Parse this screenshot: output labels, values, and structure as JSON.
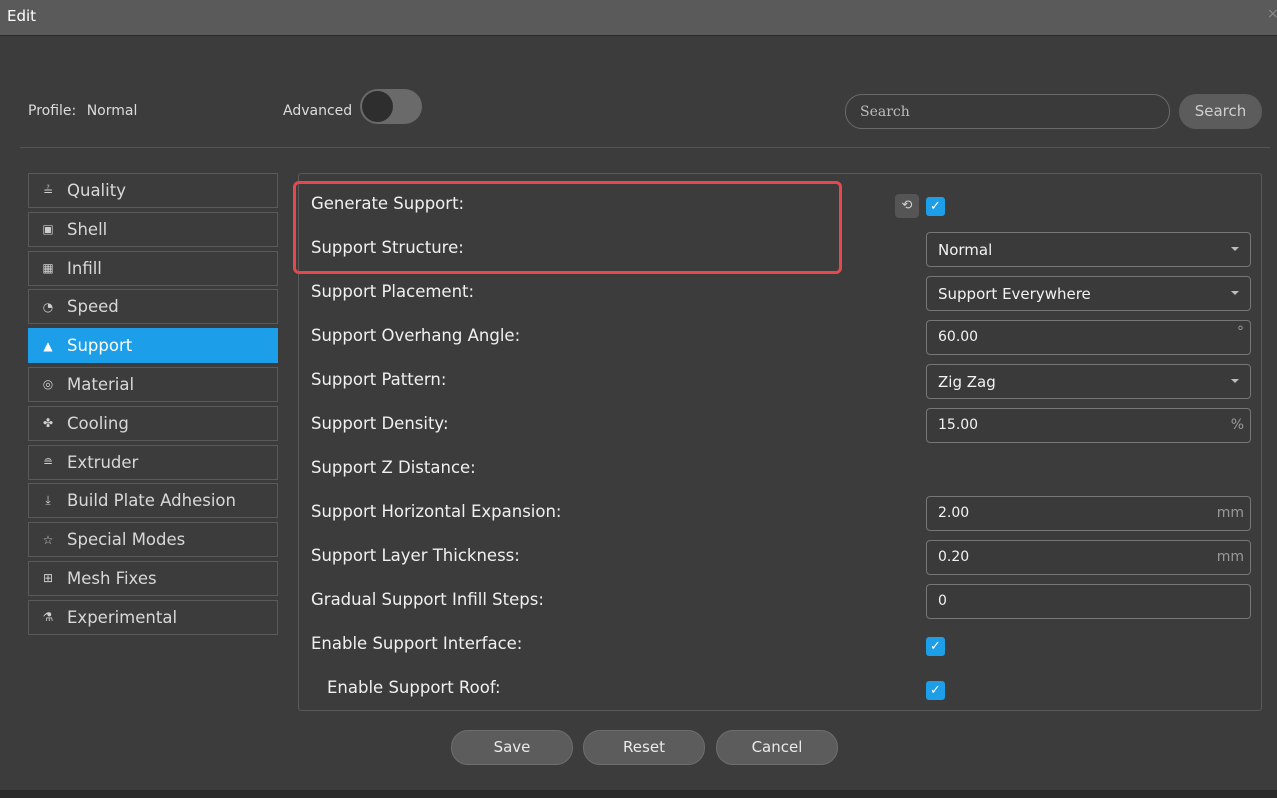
{
  "window": {
    "title": "Edit",
    "close_glyph": "×"
  },
  "toolbar": {
    "profile_label": "Profile:",
    "profile_value": "Normal",
    "advanced_label": "Advanced",
    "advanced_on": false,
    "search_placeholder": "Search",
    "search_button": "Search"
  },
  "sidebar": {
    "items": [
      {
        "label": "Quality",
        "icon": "quality-icon",
        "glyph": "≟"
      },
      {
        "label": "Shell",
        "icon": "shell-icon",
        "glyph": "▣"
      },
      {
        "label": "Infill",
        "icon": "infill-icon",
        "glyph": "▦"
      },
      {
        "label": "Speed",
        "icon": "speed-icon",
        "glyph": "◔"
      },
      {
        "label": "Support",
        "icon": "support-icon",
        "glyph": "▲",
        "active": true
      },
      {
        "label": "Material",
        "icon": "material-icon",
        "glyph": "◎"
      },
      {
        "label": "Cooling",
        "icon": "fan-icon",
        "glyph": "✤"
      },
      {
        "label": "Extruder",
        "icon": "extruder-icon",
        "glyph": "≘"
      },
      {
        "label": "Build Plate Adhesion",
        "icon": "adhesion-icon",
        "glyph": "⤓"
      },
      {
        "label": "Special Modes",
        "icon": "star-icon",
        "glyph": "☆"
      },
      {
        "label": "Mesh Fixes",
        "icon": "mesh-fix-icon",
        "glyph": "⊞"
      },
      {
        "label": "Experimental",
        "icon": "flask-icon",
        "glyph": "⚗"
      }
    ]
  },
  "settings": {
    "generate_support": {
      "label": "Generate Support:",
      "checked": true,
      "reset_glyph": "⟲"
    },
    "support_structure": {
      "label": "Support Structure:",
      "value": "Normal"
    },
    "support_placement": {
      "label": "Support Placement:",
      "value": "Support Everywhere"
    },
    "overhang_angle": {
      "label": "Support Overhang Angle:",
      "value": "60.00",
      "unit": "°"
    },
    "support_pattern": {
      "label": "Support Pattern:",
      "value": "Zig Zag"
    },
    "support_density": {
      "label": "Support Density:",
      "value": "15.00",
      "unit": "%"
    },
    "z_distance": {
      "label": "Support Z Distance:"
    },
    "horizontal_expansion": {
      "label": "Support Horizontal Expansion:",
      "value": "2.00",
      "unit": "mm"
    },
    "layer_thickness": {
      "label": "Support Layer Thickness:",
      "value": "0.20",
      "unit": "mm"
    },
    "gradual_infill_steps": {
      "label": "Gradual Support Infill Steps:",
      "value": "0"
    },
    "enable_interface": {
      "label": "Enable Support Interface:",
      "checked": true
    },
    "enable_roof": {
      "label": "Enable Support Roof:",
      "checked": true
    }
  },
  "checkmark_glyph": "✓",
  "footer": {
    "save": "Save",
    "reset": "Reset",
    "cancel": "Cancel"
  },
  "colors": {
    "accent": "#1d9ee8",
    "highlight": "#e5484d",
    "background": "#3c3c3c"
  }
}
